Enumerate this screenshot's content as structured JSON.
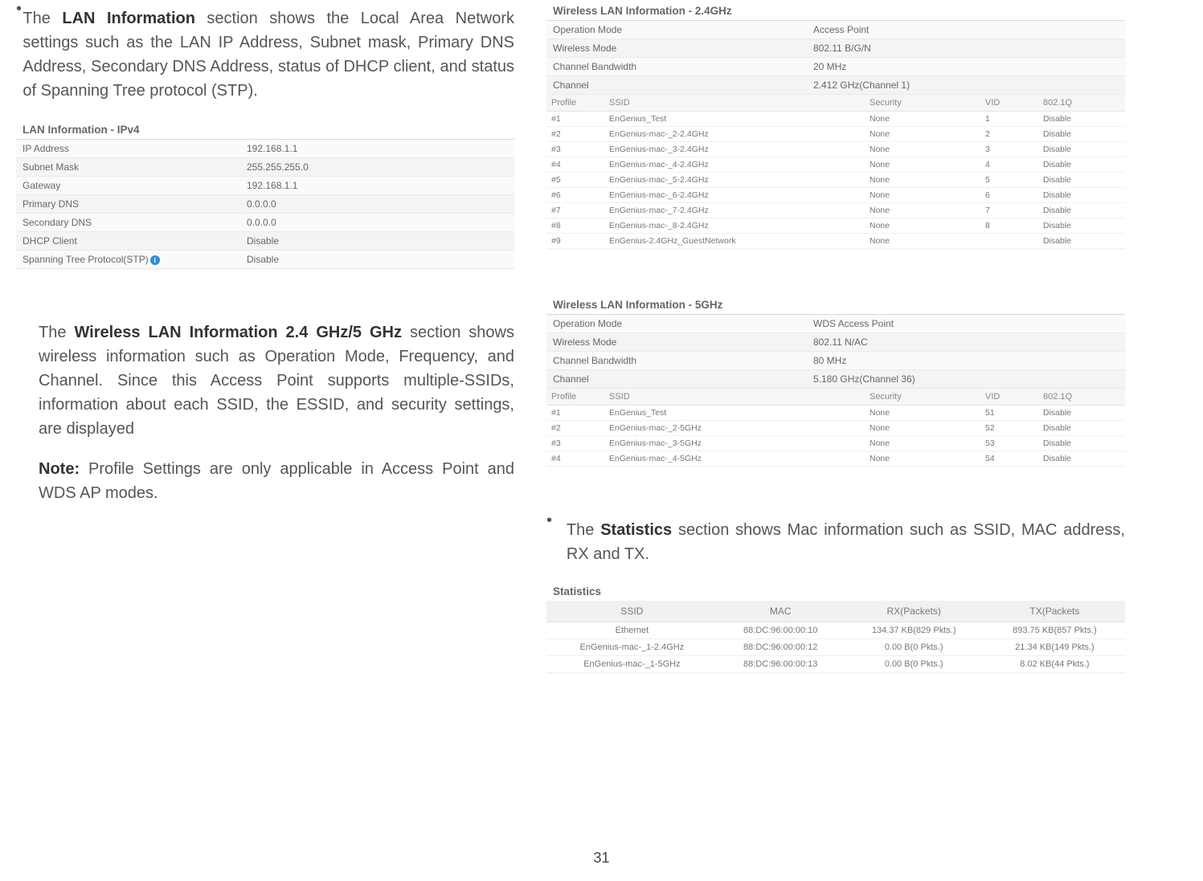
{
  "left": {
    "para1_prefix": "The ",
    "para1_bold": "LAN Information",
    "para1_rest": " section shows the Local Area Network settings such as the LAN IP Address, Subnet mask, Primary DNS Address, Secondary DNS Address, status of DHCP client, and status of Spanning Tree protocol (STP).",
    "lan_title": "LAN Information - IPv4",
    "lan_rows": [
      {
        "label": "IP Address",
        "value": "192.168.1.1"
      },
      {
        "label": "Subnet Mask",
        "value": "255.255.255.0"
      },
      {
        "label": "Gateway",
        "value": "192.168.1.1"
      },
      {
        "label": "Primary DNS",
        "value": "0.0.0.0"
      },
      {
        "label": "Secondary DNS",
        "value": "0.0.0.0"
      },
      {
        "label": "DHCP Client",
        "value": "Disable"
      },
      {
        "label": "Spanning Tree Protocol(STP)",
        "value": "Disable",
        "info": true
      }
    ],
    "para2_prefix": "The ",
    "para2_bold": "Wireless LAN Information 2.4 GHz/5 GHz",
    "para2_rest": " section shows wireless information such as Operation Mode, Frequency, and Channel. Since this Access Point supports multiple-SSIDs, information about each SSID, the ESSID, and security settings, are displayed",
    "note_bold": "Note:",
    "note_rest": " Profile Settings are only applicable in Access Point and WDS AP modes."
  },
  "right": {
    "wlan24_title": "Wireless LAN Information - 2.4GHz",
    "wlan24_info": [
      {
        "label": "Operation Mode",
        "value": "Access Point"
      },
      {
        "label": "Wireless Mode",
        "value": "802.11 B/G/N"
      },
      {
        "label": "Channel Bandwidth",
        "value": "20 MHz"
      },
      {
        "label": "Channel",
        "value": "2.412 GHz(Channel 1)"
      }
    ],
    "ssid_headers": {
      "profile": "Profile",
      "ssid": "SSID",
      "security": "Security",
      "vid": "VID",
      "q": "802.1Q"
    },
    "wlan24_ssids": [
      {
        "profile": "#1",
        "ssid": "EnGenius_Test",
        "security": "None",
        "vid": "1",
        "q": "Disable"
      },
      {
        "profile": "#2",
        "ssid": "EnGenius-mac-_2-2.4GHz",
        "security": "None",
        "vid": "2",
        "q": "Disable"
      },
      {
        "profile": "#3",
        "ssid": "EnGenius-mac-_3-2.4GHz",
        "security": "None",
        "vid": "3",
        "q": "Disable"
      },
      {
        "profile": "#4",
        "ssid": "EnGenius-mac-_4-2.4GHz",
        "security": "None",
        "vid": "4",
        "q": "Disable"
      },
      {
        "profile": "#5",
        "ssid": "EnGenius-mac-_5-2.4GHz",
        "security": "None",
        "vid": "5",
        "q": "Disable"
      },
      {
        "profile": "#6",
        "ssid": "EnGenius-mac-_6-2.4GHz",
        "security": "None",
        "vid": "6",
        "q": "Disable"
      },
      {
        "profile": "#7",
        "ssid": "EnGenius-mac-_7-2.4GHz",
        "security": "None",
        "vid": "7",
        "q": "Disable"
      },
      {
        "profile": "#8",
        "ssid": "EnGenius-mac-_8-2.4GHz",
        "security": "None",
        "vid": "8",
        "q": "Disable"
      },
      {
        "profile": "#9",
        "ssid": "EnGenius-2.4GHz_GuestNetwork",
        "security": "None",
        "vid": "",
        "q": "Disable"
      }
    ],
    "wlan5_title": "Wireless LAN Information - 5GHz",
    "wlan5_info": [
      {
        "label": "Operation Mode",
        "value": "WDS Access Point"
      },
      {
        "label": "Wireless Mode",
        "value": "802.11 N/AC"
      },
      {
        "label": "Channel Bandwidth",
        "value": "80 MHz"
      },
      {
        "label": "Channel",
        "value": "5.180 GHz(Channel 36)"
      }
    ],
    "wlan5_ssids": [
      {
        "profile": "#1",
        "ssid": "EnGenius_Test",
        "security": "None",
        "vid": "51",
        "q": "Disable"
      },
      {
        "profile": "#2",
        "ssid": "EnGenius-mac-_2-5GHz",
        "security": "None",
        "vid": "52",
        "q": "Disable"
      },
      {
        "profile": "#3",
        "ssid": "EnGenius-mac-_3-5GHz",
        "security": "None",
        "vid": "53",
        "q": "Disable"
      },
      {
        "profile": "#4",
        "ssid": "EnGenius-mac-_4-5GHz",
        "security": "None",
        "vid": "54",
        "q": "Disable"
      }
    ],
    "stats_para_prefix": "The ",
    "stats_para_bold": "Statistics",
    "stats_para_rest": " section shows Mac information such as SSID, MAC address, RX and TX.",
    "stats_title": "Statistics",
    "stats_headers": {
      "ssid": "SSID",
      "mac": "MAC",
      "rx": "RX(Packets)",
      "tx": "TX(Packets"
    },
    "stats_rows": [
      {
        "ssid": "Ethernet",
        "mac": "88:DC:96:00:00:10",
        "rx": "134.37 KB(829 Pkts.)",
        "tx": "893.75 KB(857 Pkts.)"
      },
      {
        "ssid": "EnGenius-mac-_1-2.4GHz",
        "mac": "88:DC:96:00:00:12",
        "rx": "0.00 B(0 Pkts.)",
        "tx": "21.34 KB(149 Pkts.)"
      },
      {
        "ssid": "EnGenius-mac-_1-5GHz",
        "mac": "88:DC:96:00:00:13",
        "rx": "0.00 B(0 Pkts.)",
        "tx": "8.02 KB(44 Pkts.)"
      }
    ]
  },
  "page_number": "31"
}
